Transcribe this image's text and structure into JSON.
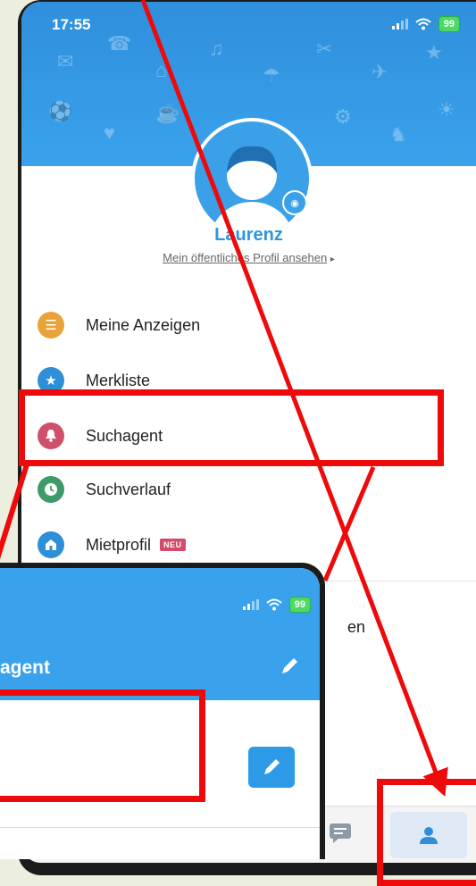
{
  "status_bar": {
    "time": "17:55",
    "battery": "99"
  },
  "profile": {
    "name": "Laurenz",
    "public_profile_link": "Mein öffentliches Profil ansehen",
    "link_arrow": "▸"
  },
  "menu": {
    "items": [
      {
        "label": "Meine Anzeigen",
        "icon": "list-icon",
        "color": "#e8a33a"
      },
      {
        "label": "Merkliste",
        "icon": "star-icon",
        "color": "#2d8fd8"
      },
      {
        "label": "Suchagent",
        "icon": "bell-icon",
        "color": "#d0506c"
      },
      {
        "label": "Suchverlauf",
        "icon": "clock-icon",
        "color": "#3f9a6a"
      },
      {
        "label": "Mietprofil",
        "icon": "house-icon",
        "color": "#2d8fd8",
        "badge": "NEU"
      }
    ],
    "partial_item_fragment": "en"
  },
  "inset": {
    "title_fragment": "agent",
    "battery": "99"
  },
  "tab_bar": {
    "active": "profile"
  },
  "colors": {
    "header_blue": "#3aa2ec",
    "highlight_red": "#ee0a0a"
  }
}
